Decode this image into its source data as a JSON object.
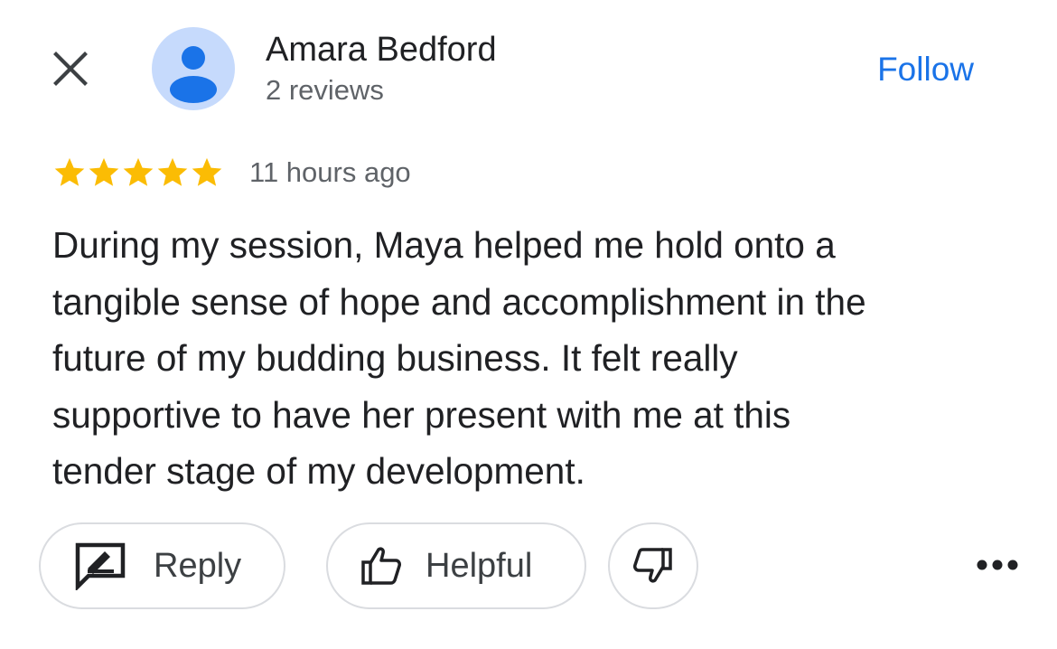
{
  "header": {
    "close_icon": "close-icon",
    "avatar_icon": "person-icon",
    "author_name": "Amara Bedford",
    "review_count": "2 reviews",
    "follow_label": "Follow"
  },
  "review": {
    "rating": 5,
    "rating_max": 5,
    "time_ago": "11 hours ago",
    "lines": [
      "During my session, Maya helped me hold onto a",
      "tangible sense of hope and accomplishment in the",
      "future of my budding business. It felt really",
      "supportive to have her present with me at this",
      "tender stage of my development."
    ]
  },
  "actions": {
    "reply_label": "Reply",
    "reply_icon": "reply-icon",
    "helpful_label": "Helpful",
    "helpful_icon": "thumbs-up-icon",
    "dislike_icon": "thumbs-down-icon",
    "more_icon": "more-horiz-icon"
  },
  "colors": {
    "accent": "#1a73e8",
    "star": "#fbbc04",
    "avatar_bg": "#c6dafc",
    "avatar_fg": "#1a73e8",
    "text_primary": "#202124",
    "text_secondary": "#5f6368",
    "border": "#dadce0"
  }
}
